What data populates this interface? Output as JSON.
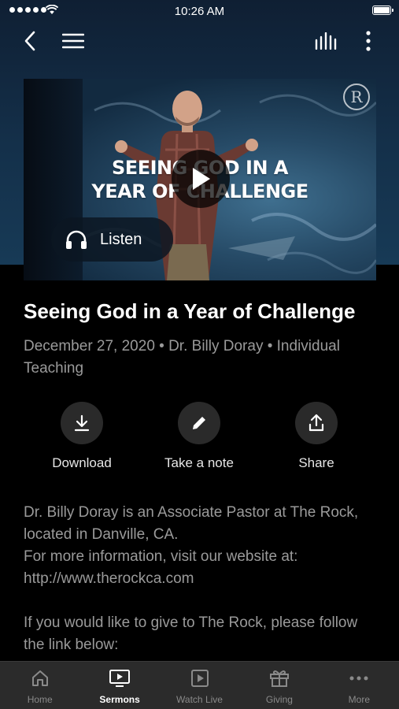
{
  "status_bar": {
    "time": "10:26 AM"
  },
  "nav": {
    "back_icon": "chevron-left-icon",
    "menu_icon": "hamburger-menu-icon",
    "audio_icon": "audio-bars-icon",
    "more_icon": "vertical-dots-icon"
  },
  "media": {
    "thumbnail_title_line1": "SEEING GOD IN A",
    "thumbnail_title_line2": "YEAR OF CHALLENGE",
    "play_icon": "play-icon",
    "logo_letter": "R",
    "listen_label": "Listen"
  },
  "sermon": {
    "title": "Seeing God in a Year of Challenge",
    "meta": "December 27, 2020 • Dr. Billy Doray • Individual Teaching"
  },
  "actions": [
    {
      "label": "Download",
      "icon": "download-icon"
    },
    {
      "label": "Take a note",
      "icon": "pencil-icon"
    },
    {
      "label": "Share",
      "icon": "share-icon"
    }
  ],
  "description": {
    "para1_line1": "Dr. Billy Doray is an Associate Pastor at The Rock, located in Danville, CA.",
    "para1_line2": "For more information, visit our website at: http://www.therockca.com",
    "para2": "If you would like to give to The Rock, please follow the link below:"
  },
  "tabs": [
    {
      "label": "Home",
      "icon": "home-icon",
      "active": false
    },
    {
      "label": "Sermons",
      "icon": "tv-play-icon",
      "active": true
    },
    {
      "label": "Watch Live",
      "icon": "video-play-icon",
      "active": false
    },
    {
      "label": "Giving",
      "icon": "gift-icon",
      "active": false
    },
    {
      "label": "More",
      "icon": "more-dots-icon",
      "active": false
    }
  ]
}
